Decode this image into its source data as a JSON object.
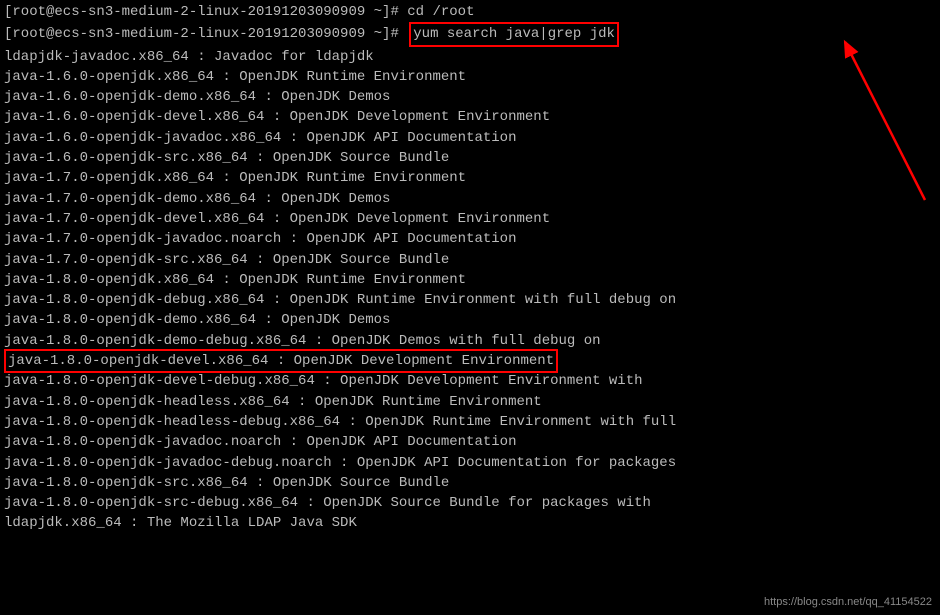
{
  "prompt1": {
    "user_host": "root@ecs-sn3-medium-2-linux-20191203090909",
    "cwd": "~",
    "cmd": "cd /root"
  },
  "prompt2": {
    "user_host": "root@ecs-sn3-medium-2-linux-20191203090909",
    "cwd": "~",
    "cmd_highlighted": "yum search java|grep jdk"
  },
  "output_lines": [
    "ldapjdk-javadoc.x86_64 : Javadoc for ldapjdk",
    "java-1.6.0-openjdk.x86_64 : OpenJDK Runtime Environment",
    "java-1.6.0-openjdk-demo.x86_64 : OpenJDK Demos",
    "java-1.6.0-openjdk-devel.x86_64 : OpenJDK Development Environment",
    "java-1.6.0-openjdk-javadoc.x86_64 : OpenJDK API Documentation",
    "java-1.6.0-openjdk-src.x86_64 : OpenJDK Source Bundle",
    "java-1.7.0-openjdk.x86_64 : OpenJDK Runtime Environment",
    "java-1.7.0-openjdk-demo.x86_64 : OpenJDK Demos",
    "java-1.7.0-openjdk-devel.x86_64 : OpenJDK Development Environment",
    "java-1.7.0-openjdk-javadoc.noarch : OpenJDK API Documentation",
    "java-1.7.0-openjdk-src.x86_64 : OpenJDK Source Bundle",
    "java-1.8.0-openjdk.x86_64 : OpenJDK Runtime Environment",
    "java-1.8.0-openjdk-debug.x86_64 : OpenJDK Runtime Environment with full debug on",
    "java-1.8.0-openjdk-demo.x86_64 : OpenJDK Demos",
    "java-1.8.0-openjdk-demo-debug.x86_64 : OpenJDK Demos with full debug on"
  ],
  "highlighted_output_line": "java-1.8.0-openjdk-devel.x86_64 : OpenJDK Development Environment",
  "output_lines_after": [
    "java-1.8.0-openjdk-devel-debug.x86_64 : OpenJDK Development Environment with ",
    "java-1.8.0-openjdk-headless.x86_64 : OpenJDK Runtime Environment",
    "java-1.8.0-openjdk-headless-debug.x86_64 : OpenJDK Runtime Environment with full",
    "java-1.8.0-openjdk-javadoc.noarch : OpenJDK API Documentation",
    "java-1.8.0-openjdk-javadoc-debug.noarch : OpenJDK API Documentation for packages",
    "java-1.8.0-openjdk-src.x86_64 : OpenJDK Source Bundle",
    "java-1.8.0-openjdk-src-debug.x86_64 : OpenJDK Source Bundle for packages with ",
    "ldapjdk.x86_64 : The Mozilla LDAP Java SDK"
  ],
  "watermark": "https://blog.csdn.net/qq_41154522"
}
